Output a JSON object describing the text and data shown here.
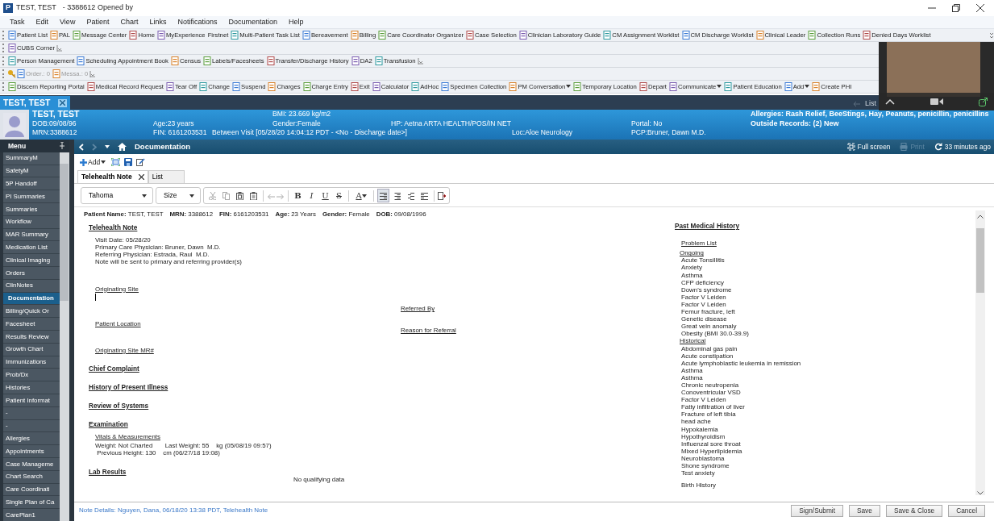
{
  "window": {
    "logo": "P",
    "title": "TEST, TEST",
    "subtitle": "- 3388612 Opened by"
  },
  "menu": [
    "Task",
    "Edit",
    "View",
    "Patient",
    "Chart",
    "Links",
    "Notifications",
    "Documentation",
    "Help"
  ],
  "toolbars": [
    [
      {
        "label": "Patient List"
      },
      {
        "label": "PAL"
      },
      {
        "label": "Message Center"
      },
      {
        "label": "Home"
      },
      {
        "label": "MyExperience"
      },
      {
        "label": "Firstnet",
        "icon": false
      },
      {
        "label": "Multi-Patient Task List"
      },
      {
        "label": "Bereavement"
      },
      {
        "label": "Billing"
      },
      {
        "label": "Care Coordinator Organizer"
      },
      {
        "label": "Case Selection"
      },
      {
        "label": "Clinician Laboratory Guide"
      },
      {
        "label": "CM Assignment Worklist"
      },
      {
        "label": "CM Discharge Worklist"
      },
      {
        "label": "Clinical Leader"
      },
      {
        "label": "Collection Runs"
      },
      {
        "label": "Denied Days Worklist"
      }
    ],
    [
      {
        "label": "CUBS Corner"
      }
    ],
    [
      {
        "label": "Person Management"
      },
      {
        "label": "Scheduling Appointment Book"
      },
      {
        "label": "Census"
      },
      {
        "label": "Labels/Facesheets"
      },
      {
        "label": "Transfer/Discharge History"
      },
      {
        "label": "DA2"
      },
      {
        "label": "Transfusion"
      }
    ],
    [
      {
        "label": "Order.: 0",
        "disabled": true
      },
      {
        "label": "Messa.: 0",
        "disabled": true
      }
    ],
    [
      {
        "label": "Discern Reporting Portal",
        "dropdown": false
      },
      {
        "label": "Medical Record Request",
        "dropdown": false
      },
      {
        "label": "Tear Off",
        "dropdown": false
      },
      {
        "label": "Change",
        "dropdown": false
      },
      {
        "label": "Suspend",
        "dropdown": false
      },
      {
        "label": "Charges",
        "dropdown": false
      },
      {
        "label": "Charge Entry",
        "dropdown": false
      },
      {
        "label": "Exit",
        "dropdown": false
      },
      {
        "label": "Calculator",
        "dropdown": false
      },
      {
        "label": "AdHoc",
        "dropdown": false
      },
      {
        "label": "Specimen Collection",
        "dropdown": false
      },
      {
        "label": "PM Conversation",
        "dropdown": true
      },
      {
        "label": "Temporary Location",
        "dropdown": false
      },
      {
        "label": "Depart",
        "dropdown": false
      },
      {
        "label": "Communicate",
        "dropdown": true
      },
      {
        "label": "Patient Education",
        "dropdown": false
      },
      {
        "label": "Add",
        "dropdown": true
      },
      {
        "label": "Create PHI",
        "dropdown": false
      }
    ]
  ],
  "patient_tab": "TEST, TEST",
  "list_link": "List",
  "banner": {
    "name": "TEST, TEST",
    "dob": "DOB:09/08/96",
    "mrn": "MRN:3388612",
    "age": "Age:23 years",
    "fin": "FIN: 6161203531",
    "visit": "Between Visit [05/28/20 14:04:12 PDT - <No - Discharge date>]",
    "bmi": "BMI: 23.669 kg/m2",
    "gender": "Gender:Female",
    "hp": "HP: Aetna ARTA HEALTH/POS/IN NET",
    "loc": "Loc:Aloe Neurology",
    "portal": "Portal: No",
    "pcp": "PCP:Bruner, Dawn  M.D.",
    "allergies": "Allergies: Rash Relief, BeeStings, Hay, Peanuts, penicillin, penicillins",
    "outside_records": "Outside Records: (2) New"
  },
  "sidebar": {
    "title": "Menu",
    "items": [
      {
        "label": "SummaryM",
        "selected": false
      },
      {
        "label": "SafetyM",
        "selected": false
      },
      {
        "label": "5P Handoff",
        "selected": false
      },
      {
        "label": "PI Summaries",
        "selected": false
      },
      {
        "label": "Summaries",
        "selected": false
      },
      {
        "label": "Workflow",
        "selected": false
      },
      {
        "label": "MAR Summary",
        "selected": false
      },
      {
        "label": "Medication List",
        "selected": false
      },
      {
        "label": "Clinical Imaging",
        "selected": false
      },
      {
        "label": "Orders",
        "selected": false
      },
      {
        "label": "ClinNotes",
        "selected": false
      },
      {
        "label": "Documentation",
        "selected": true
      },
      {
        "label": "Billing/Quick Or",
        "selected": false
      },
      {
        "label": "Facesheet",
        "selected": false
      },
      {
        "label": "Results Review",
        "selected": false
      },
      {
        "label": "Growth Chart",
        "selected": false
      },
      {
        "label": "Immunizations",
        "selected": false
      },
      {
        "label": "Prob/Dx",
        "selected": false
      },
      {
        "label": "Histories",
        "selected": false
      },
      {
        "label": "Patient Informat",
        "selected": false
      },
      {
        "label": "-",
        "selected": false
      },
      {
        "label": "-",
        "selected": false
      },
      {
        "label": "Allergies",
        "selected": false
      },
      {
        "label": "Appointments",
        "selected": false
      },
      {
        "label": "Case Manageme",
        "selected": false
      },
      {
        "label": "Chart Search",
        "selected": false
      },
      {
        "label": "Care Coordinati",
        "selected": false
      },
      {
        "label": "Single Plan of Ca",
        "selected": false
      },
      {
        "label": "CarePlan1",
        "selected": false
      }
    ]
  },
  "nav": {
    "title": "Documentation",
    "actions": [
      {
        "label": "Full screen",
        "disabled": false
      },
      {
        "label": "Print",
        "disabled": true
      },
      {
        "label": "33 minutes ago",
        "disabled": false
      }
    ]
  },
  "doc_toolbar": {
    "add": "Add"
  },
  "doc_tabs": [
    {
      "label": "Telehealth Note",
      "selected": true
    },
    {
      "label": "List",
      "selected": false
    }
  ],
  "editor": {
    "font": "Tahoma",
    "size": "Size",
    "format_buttons": [
      "B",
      "I",
      "U",
      "S"
    ],
    "color_button": "A",
    "alignments": [
      {
        "selected": true
      },
      {
        "selected": false
      },
      {
        "selected": false
      },
      {
        "selected": false
      }
    ]
  },
  "document": {
    "header": [
      {
        "label": "Patient Name:",
        "value": "TEST, TEST"
      },
      {
        "label": "MRN:",
        "value": "3388612"
      },
      {
        "label": "FIN:",
        "value": "6161203531"
      },
      {
        "label": "Age:",
        "value": "23 Years"
      },
      {
        "label": "Gender:",
        "value": "Female"
      },
      {
        "label": "DOB:",
        "value": "09/08/1996"
      }
    ],
    "left": [
      {
        "kind": "heading",
        "text": "Telehealth Note"
      },
      {
        "kind": "text",
        "text": "Visit Date: 05/28/20"
      },
      {
        "kind": "text",
        "text": "Primary Care Physician: Bruner, Dawn  M.D."
      },
      {
        "kind": "text",
        "text": "Referring Physician: Estrada, Raul  M.D."
      },
      {
        "kind": "text",
        "text": "Note will be sent to primary and referring provider(s)"
      },
      {
        "kind": "subheading",
        "text": "Originating Site"
      },
      {
        "kind": "caret"
      },
      {
        "kind": "subheading",
        "text": "Patient Location"
      },
      {
        "kind": "subheading",
        "text": "Originating Site MR#"
      },
      {
        "kind": "heading",
        "text": "Chief Complaint"
      },
      {
        "kind": "heading",
        "text": "History of Present Illness"
      },
      {
        "kind": "heading",
        "text": "Review of Systems"
      },
      {
        "kind": "heading",
        "text": "Examination"
      },
      {
        "kind": "subheading",
        "text": "Vitals & Measurements"
      },
      {
        "kind": "text",
        "text": "Weight: Not Charted       Last Weight: 55    kg (05/08/19 09:57)"
      },
      {
        "kind": "text",
        "text": " Previous Height: 130    cm (06/27/18 19:08)"
      },
      {
        "kind": "heading",
        "text": "Lab Results"
      },
      {
        "kind": "note",
        "text": "No qualifying data"
      }
    ],
    "middle": [
      "Referred By",
      "Reason for Referral"
    ],
    "right": {
      "heading": "Past Medical History",
      "subheading": "Problem List",
      "groups": [
        {
          "label": "Ongoing",
          "items": [
            "Acute Tonsillitis",
            "Anxiety",
            "Asthma",
            "CFP deficiency",
            "Down's syndrome",
            "Factor V Leiden",
            "Factor V Leiden",
            "Femur fracture, left",
            "Genetic disease",
            "Great vein anomaly",
            "Obesity (BMI 30.0-39.9)"
          ]
        },
        {
          "label": "Historical",
          "items": [
            "Abdominal gas pain",
            "Acute constipation",
            "Acute lymphoblastic leukemia in remission",
            "Asthma",
            "Asthma",
            "Chronic neutropenia",
            "Conoventricular VSD",
            "Factor V Leiden",
            "Fatty infiltration of liver",
            "Fracture of left tibia",
            "head ache",
            "Hypokalemia",
            "Hypothyroidism",
            "Influenzal sore throat",
            "Mixed Hyperlipidemia",
            "Neuroblastoma",
            "Shone syndrome",
            "Test anxiety"
          ]
        }
      ],
      "next": "Birth History"
    }
  },
  "note_details": "Note Details: Nguyen, Dana, 06/18/20 13:38 PDT, Telehealth Note",
  "buttons": [
    "Sign/Submit",
    "Save",
    "Save & Close",
    "Cancel"
  ]
}
